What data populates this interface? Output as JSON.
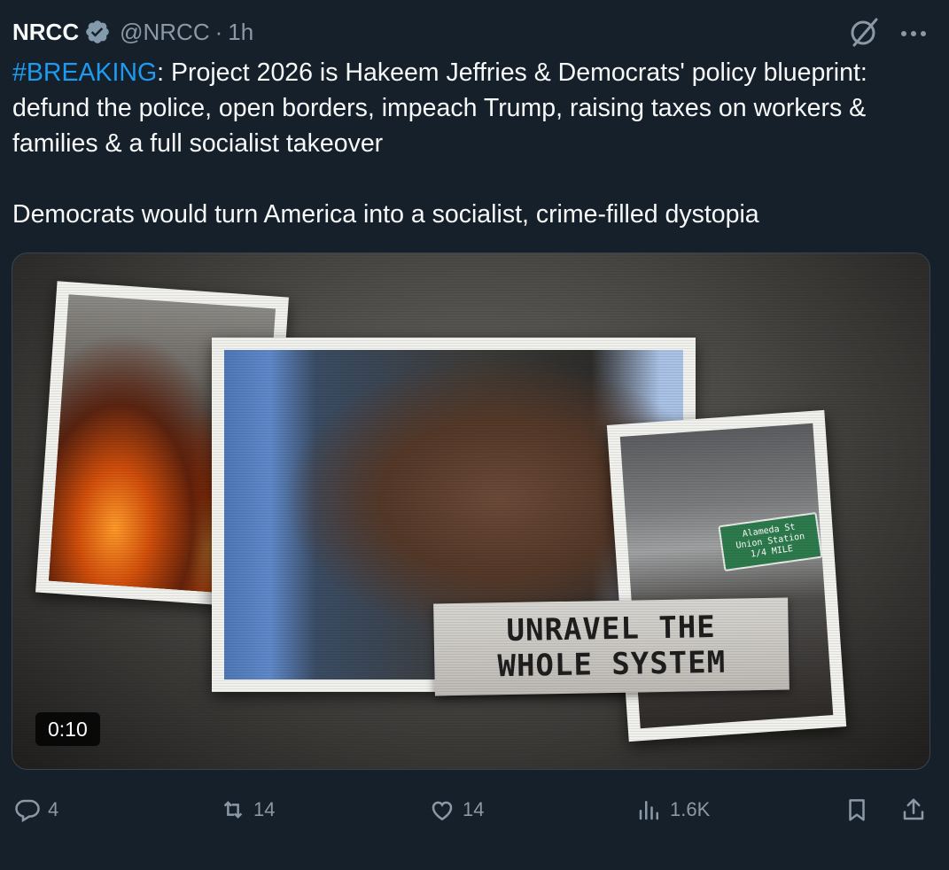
{
  "author": {
    "name": "NRCC",
    "handle": "@NRCC",
    "separator": "·",
    "time": "1h"
  },
  "tweet": {
    "hashtag": "#BREAKING",
    "line1_rest": ": Project 2026 is Hakeem Jeffries & Democrats' policy blueprint: defund the police, open borders, impeach Trump, raising taxes on workers & families & a full socialist takeover",
    "line2": "Democrats would turn America into a socialist, crime-filled dystopia"
  },
  "media": {
    "caption": "UNRAVEL THE\nWHOLE SYSTEM",
    "duration": "0:10",
    "sign_text": "Alameda St\nUnion Station\n1/4 MILE"
  },
  "actions": {
    "replies": "4",
    "reposts": "14",
    "likes": "14",
    "views": "1.6K"
  },
  "colors": {
    "background": "#15202b",
    "text": "#f7f9f9",
    "muted": "#8b98a5",
    "accent": "#1d9bf0"
  },
  "icons": [
    "verified-badge-icon",
    "grok-icon",
    "more-icon",
    "reply-icon",
    "repost-icon",
    "like-icon",
    "views-icon",
    "bookmark-icon",
    "share-icon"
  ]
}
